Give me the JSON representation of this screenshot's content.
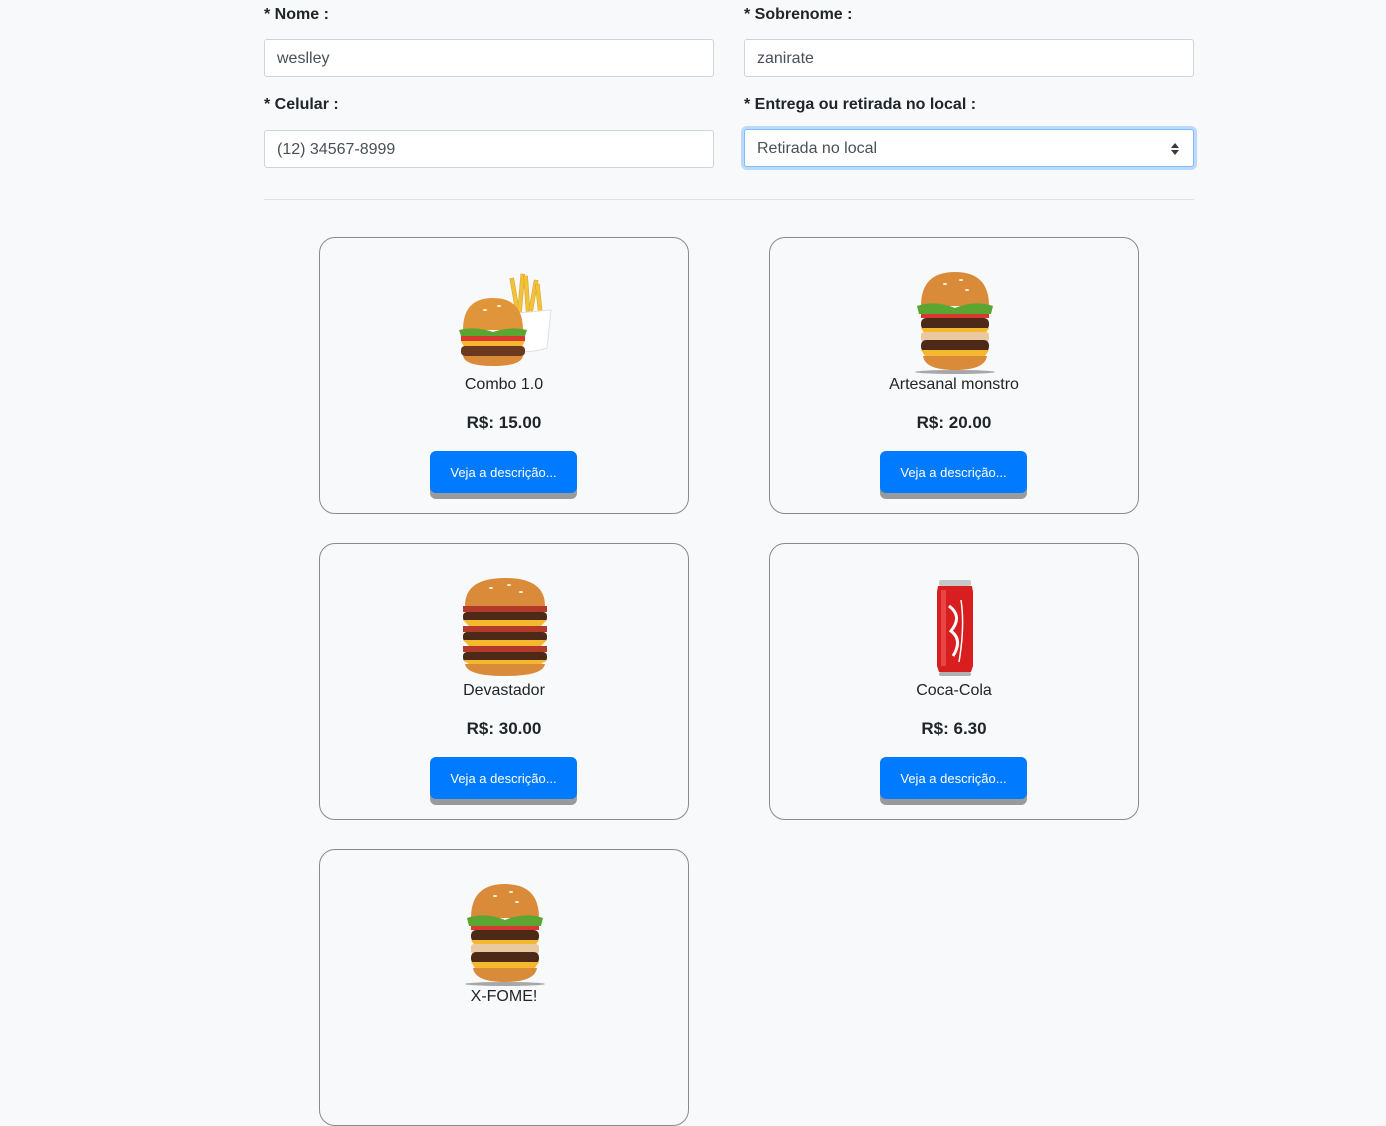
{
  "form": {
    "nome": {
      "label": "* Nome :",
      "value": "weslley"
    },
    "sobrenome": {
      "label": "* Sobrenome :",
      "value": "zanirate"
    },
    "celular": {
      "label": "* Celular :",
      "value": "(12) 34567-8999"
    },
    "entrega": {
      "label": "* Entrega ou retirada no local :",
      "selected": "Retirada no local"
    }
  },
  "products": [
    {
      "name": "Combo 1.0",
      "price": "R$: 15.00",
      "button": "Veja a descrição...",
      "icon": "burger-fries-combo"
    },
    {
      "name": "Artesanal monstro",
      "price": "R$: 20.00",
      "button": "Veja a descrição...",
      "icon": "double-burger"
    },
    {
      "name": "Devastador",
      "price": "R$: 30.00",
      "button": "Veja a descrição...",
      "icon": "triple-burger"
    },
    {
      "name": "Coca-Cola",
      "price": "R$: 6.30",
      "button": "Veja a descrição...",
      "icon": "soda-can"
    },
    {
      "name": "X-FOME!",
      "price": "",
      "button": "",
      "icon": "double-burger"
    }
  ],
  "colors": {
    "primary": "#007bff",
    "background": "#f8f9fa",
    "focus": "#80bdff",
    "soda": "#d81e1e"
  }
}
